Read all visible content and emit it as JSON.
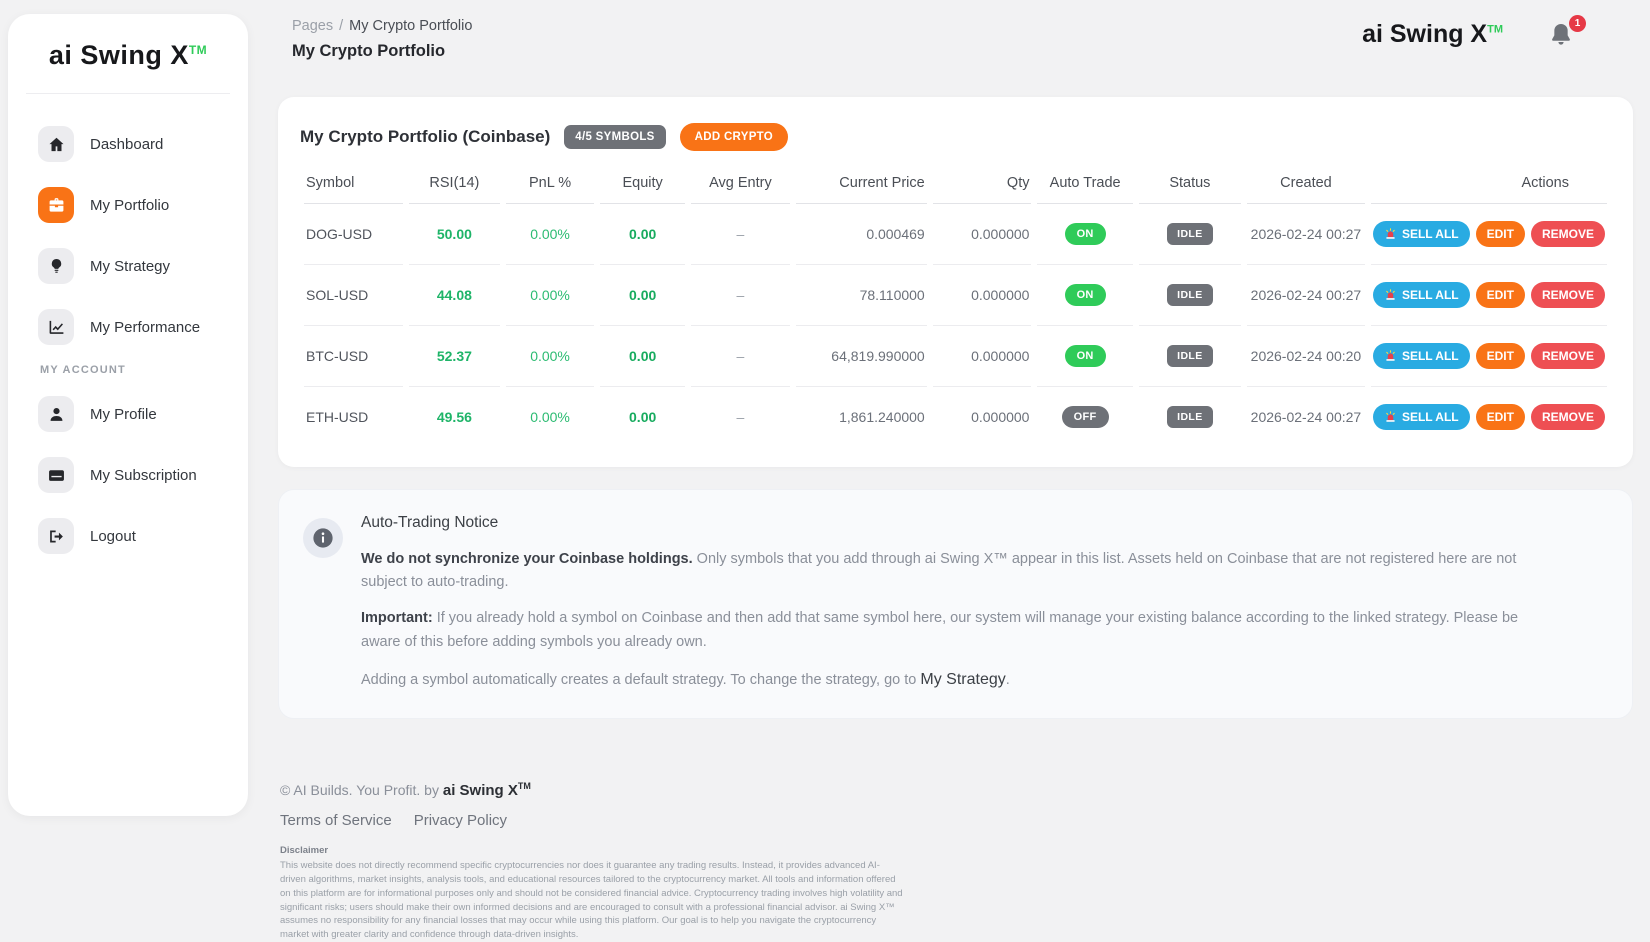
{
  "brand": {
    "name": "ai Swing X",
    "tm": "TM"
  },
  "topbar": {
    "breadcrumb_root": "Pages",
    "breadcrumb_sep": "/",
    "breadcrumb_current": "My Crypto Portfolio",
    "page_title": "My Crypto Portfolio",
    "notification_count": "1"
  },
  "sidebar": {
    "items": [
      {
        "label": "Dashboard",
        "icon": "home-icon",
        "active": false
      },
      {
        "label": "My Portfolio",
        "icon": "briefcase-icon",
        "active": true
      },
      {
        "label": "My Strategy",
        "icon": "lightbulb-icon",
        "active": false
      },
      {
        "label": "My Performance",
        "icon": "chart-line-icon",
        "active": false
      },
      {
        "label": "My Profile",
        "icon": "user-icon",
        "active": false,
        "section_before": "MY ACCOUNT"
      },
      {
        "label": "My Subscription",
        "icon": "credit-card-icon",
        "active": false
      },
      {
        "label": "Logout",
        "icon": "logout-icon",
        "active": false
      }
    ]
  },
  "portfolio": {
    "title": "My Crypto Portfolio (Coinbase)",
    "symbols_badge": "4/5 SYMBOLS",
    "add_button": "ADD CRYPTO",
    "columns": [
      "Symbol",
      "RSI(14)",
      "PnL %",
      "Equity",
      "Avg Entry",
      "Current Price",
      "Qty",
      "Auto Trade",
      "Status",
      "Created",
      "Actions"
    ],
    "action_labels": {
      "sell_all": "SELL ALL",
      "edit": "EDIT",
      "remove": "REMOVE"
    },
    "rows": [
      {
        "symbol": "DOG-USD",
        "rsi": "50.00",
        "pnl": "0.00%",
        "equity": "0.00",
        "avg_entry": "–",
        "current_price": "0.000469",
        "qty": "0.000000",
        "auto_trade": "ON",
        "status": "IDLE",
        "created": "2026-02-24 00:27"
      },
      {
        "symbol": "SOL-USD",
        "rsi": "44.08",
        "pnl": "0.00%",
        "equity": "0.00",
        "avg_entry": "–",
        "current_price": "78.110000",
        "qty": "0.000000",
        "auto_trade": "ON",
        "status": "IDLE",
        "created": "2026-02-24 00:27"
      },
      {
        "symbol": "BTC-USD",
        "rsi": "52.37",
        "pnl": "0.00%",
        "equity": "0.00",
        "avg_entry": "–",
        "current_price": "64,819.990000",
        "qty": "0.000000",
        "auto_trade": "ON",
        "status": "IDLE",
        "created": "2026-02-24 00:20"
      },
      {
        "symbol": "ETH-USD",
        "rsi": "49.56",
        "pnl": "0.00%",
        "equity": "0.00",
        "avg_entry": "–",
        "current_price": "1,861.240000",
        "qty": "0.000000",
        "auto_trade": "OFF",
        "status": "IDLE",
        "created": "2026-02-24 00:27"
      }
    ]
  },
  "notice": {
    "title": "Auto-Trading Notice",
    "p1_bold": "We do not synchronize your Coinbase holdings.",
    "p1_rest": " Only symbols that you add through ai Swing X™ appear in this list. Assets held on Coinbase that are not registered here are not subject to auto-trading.",
    "p2_bold": "Important:",
    "p2_rest": " If you already hold a symbol on Coinbase and then add that same symbol here, our system will manage your existing balance according to the linked strategy. Please be aware of this before adding symbols you already own.",
    "p3_pre": "Adding a symbol automatically creates a default strategy. To change the strategy, go to ",
    "p3_link": "My Strategy",
    "p3_post": "."
  },
  "footer": {
    "copyright_pre": "© AI Builds. You Profit. by ",
    "terms": "Terms of Service",
    "privacy": "Privacy Policy",
    "disclaimer_title": "Disclaimer",
    "disclaimer_text": "This website does not directly recommend specific cryptocurrencies nor does it guarantee any trading results. Instead, it provides advanced AI-driven algorithms, market insights, analysis tools, and educational resources tailored to the cryptocurrency market. All tools and information offered on this platform are for informational purposes only and should not be considered financial advice. Cryptocurrency trading involves high volatility and significant risks; users should make their own informed decisions and are encouraged to consult with a professional financial advisor. ai Swing X™ assumes no responsibility for any financial losses that may occur while using this platform. Our goal is to help you navigate the cryptocurrency market with greater clarity and confidence through data-driven insights."
  },
  "colors": {
    "accent_orange": "#f97316",
    "green": "#2fcb59",
    "blue": "#29abe2",
    "red": "#ee4f53",
    "gray_badge": "#6e7177",
    "page_bg": "#f2f2f3"
  }
}
